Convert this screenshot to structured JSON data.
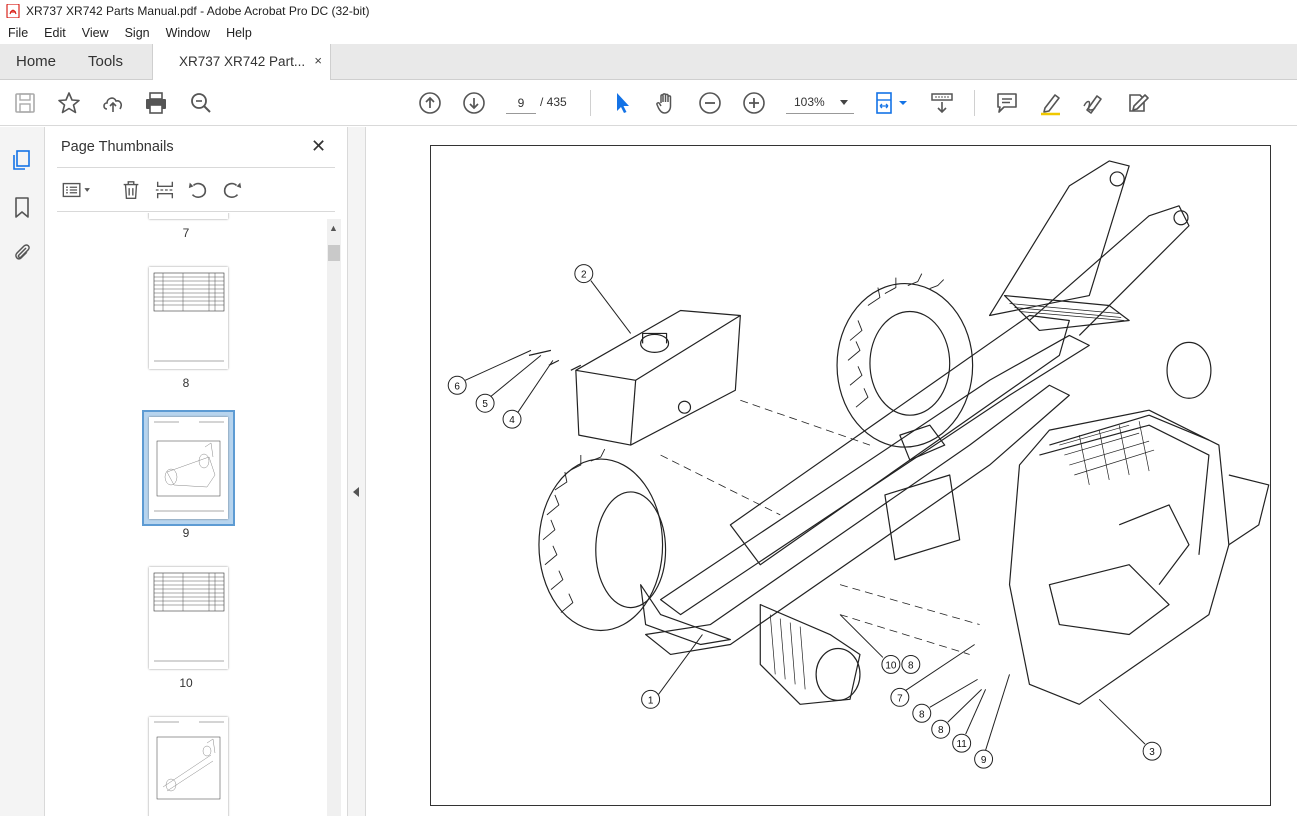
{
  "window": {
    "title": "XR737 XR742  Parts Manual.pdf - Adobe Acrobat Pro DC (32-bit)"
  },
  "menu": [
    "File",
    "Edit",
    "View",
    "Sign",
    "Window",
    "Help"
  ],
  "tabs": {
    "home": "Home",
    "tools": "Tools",
    "document": "XR737 XR742  Part...",
    "close": "×"
  },
  "toolbar": {
    "current_page": "9",
    "page_total": "/  435",
    "zoom": "103%"
  },
  "thumbnails_panel": {
    "title": "Page Thumbnails",
    "close": "✕",
    "pages": [
      {
        "label": "7",
        "kind": "partial"
      },
      {
        "label": "8",
        "kind": "table"
      },
      {
        "label": "9",
        "kind": "drawing",
        "selected": true
      },
      {
        "label": "10",
        "kind": "table"
      },
      {
        "label": "",
        "kind": "drawing"
      }
    ]
  },
  "drawing": {
    "callouts": [
      "1",
      "2",
      "3",
      "4",
      "5",
      "6",
      "7",
      "8",
      "8",
      "8",
      "9",
      "10",
      "11"
    ]
  },
  "colors": {
    "accent_red": "#d9251d",
    "select_blue": "#5d9bd3",
    "icon_gray": "#555555"
  }
}
